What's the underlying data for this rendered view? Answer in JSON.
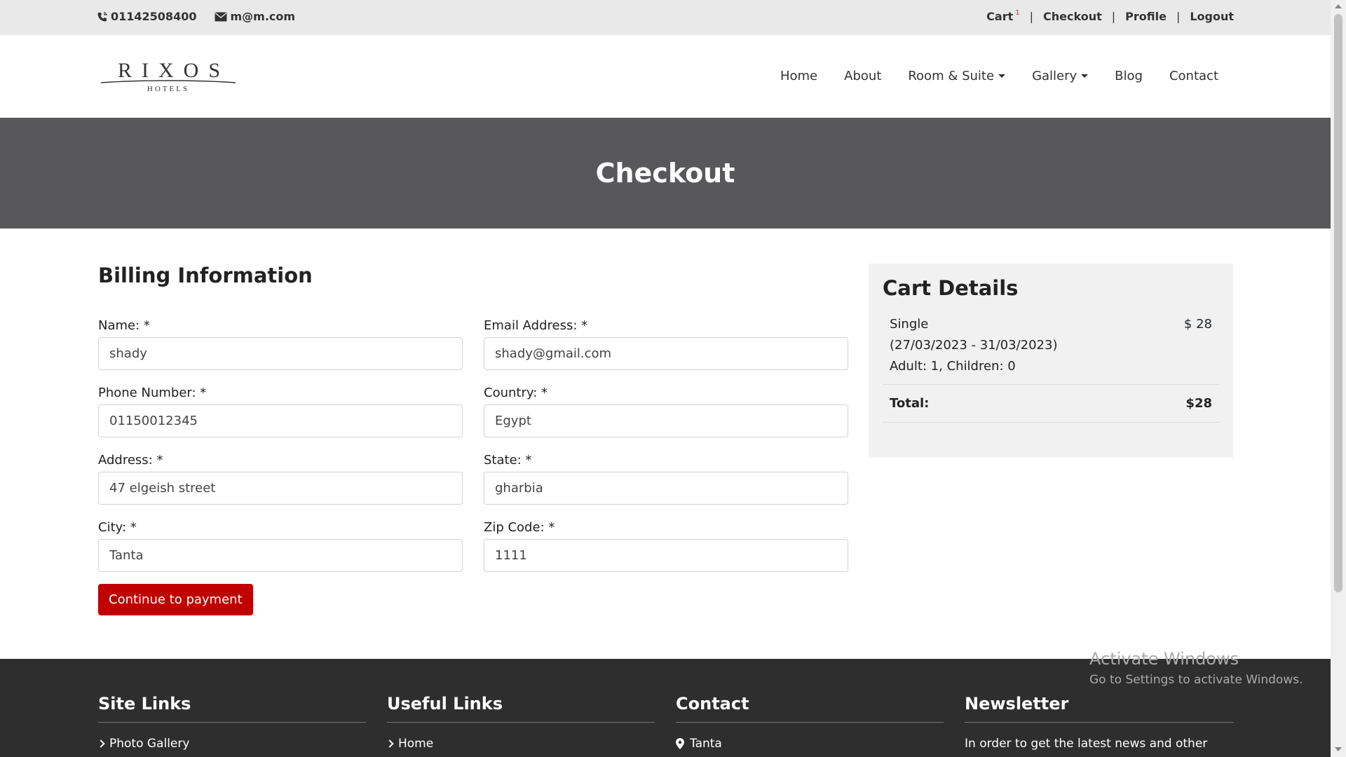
{
  "topbar": {
    "phone": "01142508400",
    "email": "m@m.com",
    "links": {
      "cart": "Cart",
      "cart_count": "1",
      "checkout": "Checkout",
      "profile": "Profile",
      "logout": "Logout",
      "separator": "|"
    }
  },
  "brand": {
    "name": "RIXOS",
    "subtitle": "HOTELS"
  },
  "nav": {
    "home": "Home",
    "about": "About",
    "rooms": "Room & Suite",
    "gallery": "Gallery",
    "blog": "Blog",
    "contact": "Contact"
  },
  "hero": {
    "title": "Checkout"
  },
  "billing": {
    "title": "Billing Information",
    "fields": {
      "name": {
        "label": "Name: *",
        "value": "shady"
      },
      "email": {
        "label": "Email Address: *",
        "value": "shady@gmail.com"
      },
      "phone": {
        "label": "Phone Number: *",
        "value": "01150012345"
      },
      "country": {
        "label": "Country: *",
        "value": "Egypt"
      },
      "address": {
        "label": "Address: *",
        "value": "47 elgeish street"
      },
      "state": {
        "label": "State: *",
        "value": "gharbia"
      },
      "city": {
        "label": "City: *",
        "value": "Tanta"
      },
      "zip": {
        "label": "Zip Code: *",
        "value": "1111"
      }
    },
    "submit_label": "Continue to payment"
  },
  "cart": {
    "title": "Cart Details",
    "item": {
      "room": "Single",
      "dates": "(27/03/2023 - 31/03/2023)",
      "guests": "Adult: 1, Children: 0",
      "price": "$ 28"
    },
    "total_label": "Total:",
    "total_value": "$28"
  },
  "footer": {
    "site_links": {
      "title": "Site Links",
      "first": "Photo Gallery"
    },
    "useful_links": {
      "title": "Useful Links",
      "first": "Home"
    },
    "contact": {
      "title": "Contact",
      "first": "Tanta"
    },
    "newsletter": {
      "title": "Newsletter",
      "text": "In order to get the latest news and other"
    }
  },
  "watermark": {
    "line1": "Activate Windows",
    "line2": "Go to Settings to activate Windows."
  },
  "colors": {
    "topbar_bg": "#e9e9ea",
    "hero_bg": "#58585b",
    "accent": "#c00000",
    "cart_bg": "#f1f1f2",
    "footer_bg": "#2e2e2f"
  }
}
